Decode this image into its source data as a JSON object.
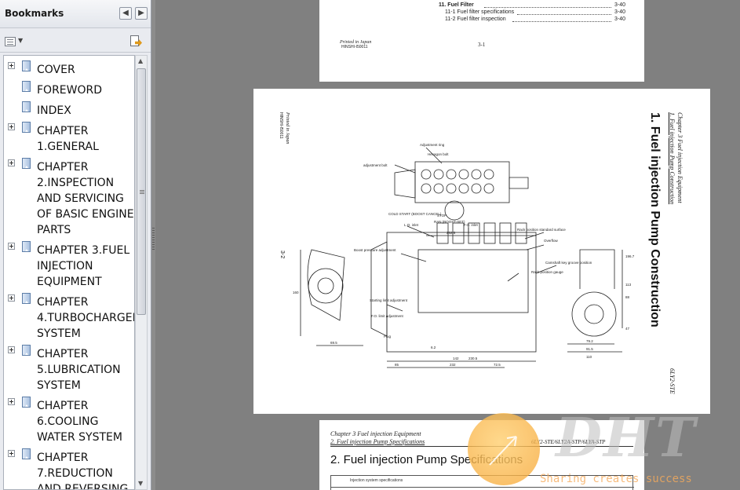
{
  "panel": {
    "title": "Bookmarks",
    "collapse_label": "◀",
    "expand_label": "▶"
  },
  "bookmarks": [
    {
      "label": "COVER",
      "expandable": true
    },
    {
      "label": "FOREWORD",
      "expandable": false
    },
    {
      "label": "INDEX",
      "expandable": false
    },
    {
      "label": "CHAPTER\n1.GENERAL",
      "expandable": true
    },
    {
      "label": "CHAPTER\n2.INSPECTION\nAND SERVICING\nOF BASIC ENGINE\nPARTS",
      "expandable": true
    },
    {
      "label": "CHAPTER 3.FUEL\nINJECTION\nEQUIPMENT",
      "expandable": true
    },
    {
      "label": "CHAPTER\n4.TURBOCHARGER\nSYSTEM",
      "expandable": true
    },
    {
      "label": "CHAPTER\n5.LUBRICATION\nSYSTEM",
      "expandable": true
    },
    {
      "label": "CHAPTER\n6.COOLING\nWATER SYSTEM",
      "expandable": true
    },
    {
      "label": "CHAPTER\n7.REDUCTION\nAND REVERSING",
      "expandable": true
    }
  ],
  "page_top": {
    "toc": [
      {
        "text": "11. Fuel Filter",
        "page": "3-40",
        "bold": true
      },
      {
        "text": "11-1  Fuel filter specifications",
        "page": "3-40"
      },
      {
        "text": "11-2  Fuel filter inspection",
        "page": "3-40"
      }
    ],
    "printed": "Printed in Japan",
    "code": "HINSHI-I50011",
    "page_number": "3-1"
  },
  "page_mid": {
    "section_title": "1.  Fuel injection Pump Construction",
    "chapter_ref": "Chapter 3 Fuel injection Equipment",
    "sub_ref": "1. Fuel injection Pump Construction",
    "model": "6LY2-STE",
    "printed": "Printed in Japan",
    "code": "HINSHI-I50011",
    "page_side": "3-2",
    "callouts": [
      "Adjustment ring",
      "Hexagon bolt",
      "adjustment bolt",
      "COLD START (BOOST CANCEL)",
      "STOP",
      "RAN (BOOST-SET)",
      "L.O. inlet",
      "F.O. inlet",
      "Rack position standard surface",
      "Overflow",
      "Boost pressure adjustment",
      "Camshaft key groove position",
      "Rack position gauge",
      "Starting limit adjustment",
      "F.O. limit adjustment",
      "Plug"
    ],
    "dimensions": [
      "252.5",
      "196.7",
      "113",
      "88",
      "160",
      "69.5",
      "85",
      "232",
      "142",
      "72.5",
      "230.5",
      "79.2",
      "91.5",
      "110",
      "47",
      "6.2"
    ]
  },
  "page_bot": {
    "chapter_line": "Chapter 3 Fuel injection Equipment",
    "section_line": "2. Fuel injection Pump Specifications",
    "model_line": "6LY2-STE/6LY2A-STP/6LYA-STP",
    "heading": "2.  Fuel injection Pump  Specifications",
    "table_caption": "Injection system specifications"
  },
  "watermark": {
    "brand": "DHT",
    "tagline": "Sharing creates success"
  }
}
